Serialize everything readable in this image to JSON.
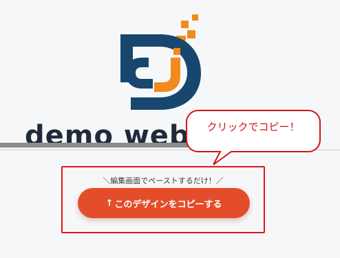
{
  "brand": {
    "site_name": "demo web",
    "logo_icon": "dd-logo-icon",
    "colors": {
      "navy": "#17476e",
      "orange": "#f28a1d"
    }
  },
  "tooltip": {
    "text": "クリックでコピー！"
  },
  "copy_section": {
    "hint": "＼編集画面でペーストするだけ！／",
    "button_arrow": "↑",
    "button_label": "このデザインをコピーする",
    "colors": {
      "button": "#e44d2a",
      "highlight_border": "#e1141b"
    }
  }
}
